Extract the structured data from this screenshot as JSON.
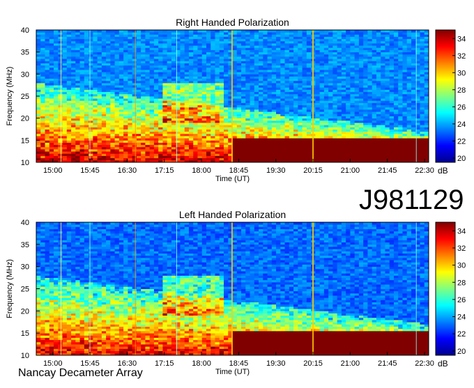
{
  "observation_id": "J981129",
  "instrument": "Nancay Decameter Array",
  "colorbar_unit": "dB",
  "colormap": [
    "#00008f",
    "#0000ff",
    "#0080ff",
    "#00ffff",
    "#80ff80",
    "#ffff00",
    "#ff8000",
    "#ff0000",
    "#800000"
  ],
  "chart_data": [
    {
      "type": "heatmap",
      "title": "Right Handed Polarization",
      "xlabel": "Time (UT)",
      "ylabel": "Frequency (MHz)",
      "x_ticks": [
        "15:00",
        "15:45",
        "16:30",
        "17:15",
        "18:00",
        "18:45",
        "19:30",
        "20:15",
        "21:00",
        "21:45",
        "22:30"
      ],
      "x_range": [
        "14:40",
        "22:35"
      ],
      "ylim": [
        10,
        40
      ],
      "y_ticks": [
        10,
        15,
        20,
        25,
        30,
        35,
        40
      ],
      "colorbar_ticks": [
        20,
        22,
        24,
        26,
        28,
        30,
        32,
        34
      ],
      "colorbar_range": [
        19.5,
        35
      ]
    },
    {
      "type": "heatmap",
      "title": "Left Handed Polarization",
      "xlabel": "Time (UT)",
      "ylabel": "Frequency (MHz)",
      "x_ticks": [
        "15:00",
        "15:45",
        "16:30",
        "17:15",
        "18:00",
        "18:45",
        "19:30",
        "20:15",
        "21:00",
        "21:45",
        "22:30"
      ],
      "x_range": [
        "14:40",
        "22:35"
      ],
      "ylim": [
        10,
        40
      ],
      "y_ticks": [
        10,
        15,
        20,
        25,
        30,
        35,
        40
      ],
      "colorbar_ticks": [
        20,
        22,
        24,
        26,
        28,
        30,
        32,
        34
      ],
      "colorbar_range": [
        19.5,
        35
      ]
    }
  ]
}
